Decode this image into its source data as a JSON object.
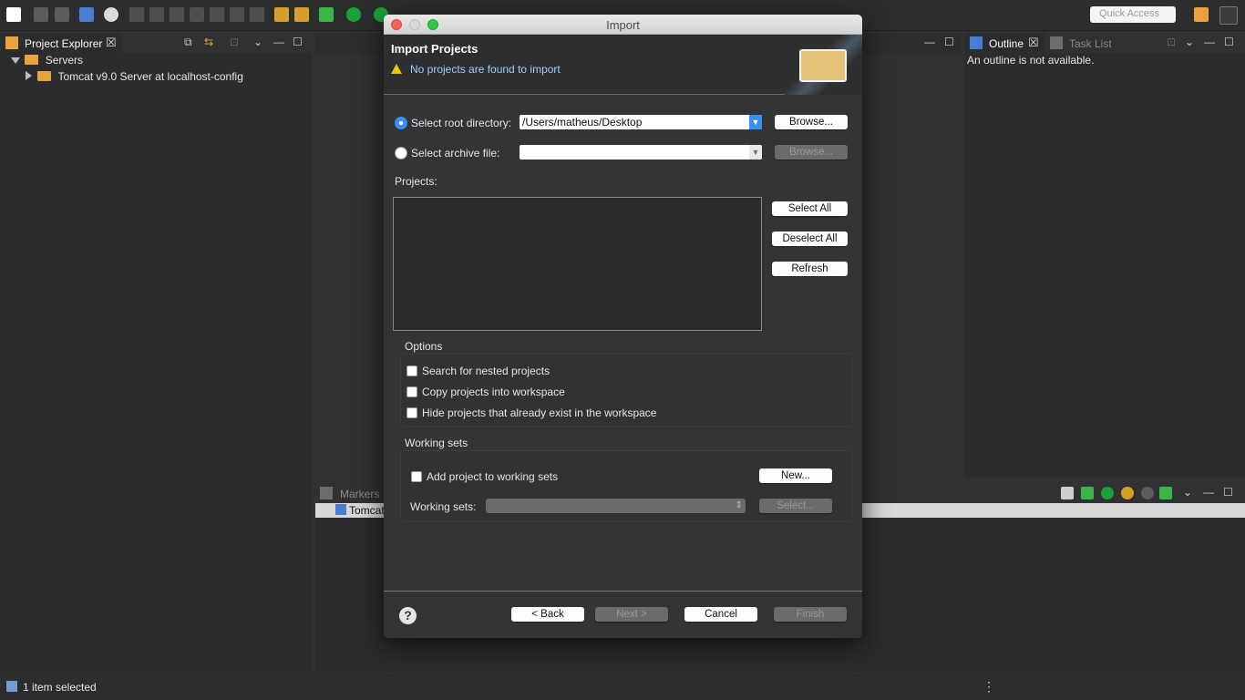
{
  "toolbar": {
    "quick_access_placeholder": "Quick Access"
  },
  "project_explorer": {
    "tab_label": "Project Explorer",
    "tree": [
      {
        "label": "Servers",
        "expanded": true
      },
      {
        "label": "Tomcat v9.0 Server at localhost-config",
        "expanded": false
      }
    ]
  },
  "outline": {
    "tab_label": "Outline",
    "task_list_label": "Task List",
    "empty_message": "An outline is not available."
  },
  "markers": {
    "tab_label": "Markers",
    "row_text": "Tomcat"
  },
  "status_bar": {
    "text": "1 item selected"
  },
  "dialog": {
    "window_title": "Import",
    "heading": "Import Projects",
    "message": "No projects are found to import",
    "root_dir_label": "Select root directory:",
    "root_dir_value": "/Users/matheus/Desktop",
    "archive_label": "Select archive file:",
    "archive_value": "",
    "browse_label": "Browse...",
    "projects_label": "Projects:",
    "select_all_label": "Select All",
    "deselect_all_label": "Deselect All",
    "refresh_label": "Refresh",
    "options_label": "Options",
    "options": [
      {
        "label": "Search for nested projects",
        "checked": false
      },
      {
        "label": "Copy projects into workspace",
        "checked": false
      },
      {
        "label": "Hide projects that already exist in the workspace",
        "checked": false
      }
    ],
    "working_sets_group_label": "Working sets",
    "add_to_working_sets_label": "Add project to working sets",
    "new_button_label": "New...",
    "working_sets_field_label": "Working sets:",
    "select_button_label": "Select...",
    "back_label": "< Back",
    "next_label": "Next >",
    "cancel_label": "Cancel",
    "finish_label": "Finish",
    "help_label": "?"
  },
  "colors": {
    "accent": "#3b8ff3",
    "warning": "#f5c400",
    "folder": "#e8a33d"
  }
}
